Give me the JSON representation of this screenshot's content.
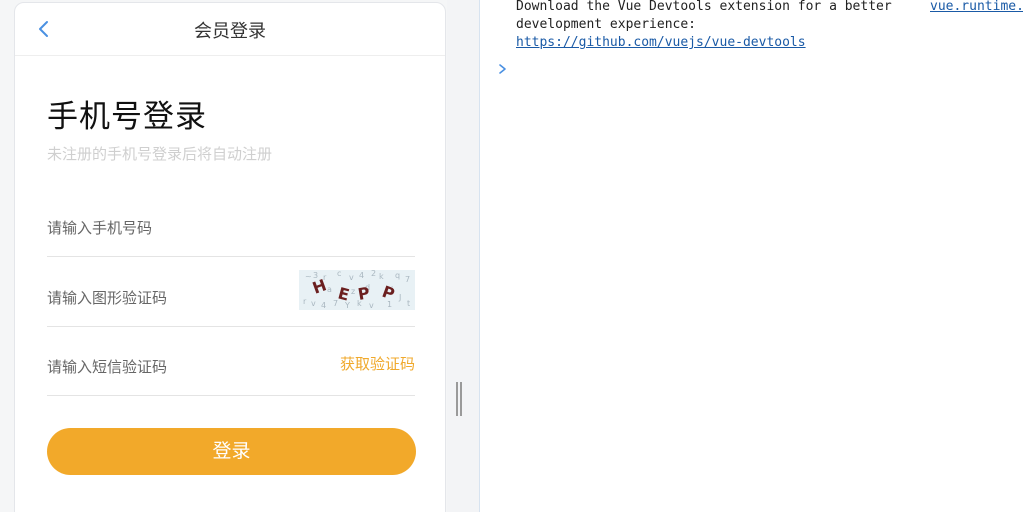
{
  "header": {
    "title": "会员登录"
  },
  "login": {
    "title": "手机号登录",
    "subtitle": "未注册的手机号登录后将自动注册",
    "phone_placeholder": "请输入手机号码",
    "captcha_placeholder": "请输入图形验证码",
    "captcha_text": "HEPP",
    "sms_placeholder": "请输入短信验证码",
    "sms_button": "获取验证码",
    "submit_label": "登录"
  },
  "colors": {
    "accent": "#f2a92a",
    "link": "#1a5aa6"
  },
  "console": {
    "message_line1": "Download the Vue Devtools extension for a better",
    "message_line2": "development experience:",
    "message_link": "https://github.com/vuejs/vue-devtools",
    "source": "vue.runtime.esm.js"
  },
  "icons": {
    "back": "chevron-left-icon",
    "prompt": "chevron-right-icon",
    "splitter": "drag-handle-icon"
  }
}
